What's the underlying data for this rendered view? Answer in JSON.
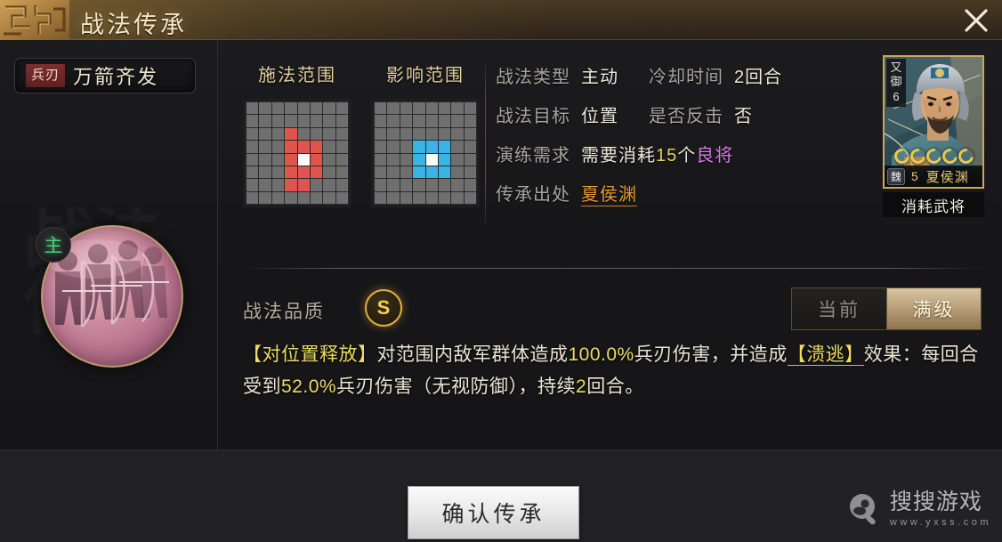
{
  "window": {
    "title": "战法传承",
    "close_icon": "close-icon"
  },
  "skill": {
    "type_tag": "兵刃",
    "name": "万箭齐发",
    "icon_badge": "主",
    "icon_name": "archers-volley-icon"
  },
  "ranges": {
    "cast_range_label": "施法范围",
    "effect_range_label": "影响范围",
    "grid_size": 8,
    "cast_cells_red": [
      [
        3,
        4
      ],
      [
        4,
        3
      ],
      [
        4,
        4
      ],
      [
        4,
        5
      ],
      [
        2,
        3
      ],
      [
        3,
        3
      ],
      [
        5,
        3
      ],
      [
        6,
        3
      ],
      [
        3,
        5
      ],
      [
        4,
        5
      ],
      [
        5,
        5
      ],
      [
        5,
        4
      ],
      [
        6,
        4
      ]
    ],
    "center_cell": [
      4,
      4
    ],
    "effect_cells_blue": [
      [
        3,
        3
      ],
      [
        3,
        4
      ],
      [
        3,
        5
      ],
      [
        4,
        3
      ],
      [
        4,
        5
      ],
      [
        5,
        3
      ],
      [
        5,
        4
      ],
      [
        5,
        5
      ]
    ]
  },
  "stats": [
    {
      "label": "战法类型",
      "value": "主动"
    },
    {
      "label": "冷却时间",
      "value": "2回合"
    },
    {
      "label": "战法目标",
      "value": "位置"
    },
    {
      "label": "是否反击",
      "value": "否"
    }
  ],
  "requirement": {
    "label": "演练需求",
    "prefix": "需要消耗",
    "count": "15",
    "unit": "个",
    "material": "良将"
  },
  "source": {
    "label": "传承出处",
    "value": "夏侯渊"
  },
  "general_card": {
    "side_badge_line1": "又",
    "side_badge_line2": "御",
    "side_badge_line3": "6",
    "stars": 5,
    "faction": "魏",
    "level": "5",
    "name": "夏侯渊",
    "caption": "消耗武将"
  },
  "quality": {
    "label": "战法品质",
    "grade": "S"
  },
  "level_toggle": {
    "current_label": "当前",
    "max_label": "满级",
    "selected": "满级"
  },
  "description": {
    "seg1": "【对位置释放】",
    "seg2": "对范围内敌军群体造成",
    "seg3": "100.0%",
    "seg4": "兵刃伤害，并造成",
    "seg5": "【溃逃】",
    "seg6": "效果：每回合受到",
    "seg7": "52.0%",
    "seg8": "兵刃伤害（无视防御），持续",
    "seg9": "2",
    "seg10": "回合。"
  },
  "footer": {
    "confirm_label": "确认传承"
  },
  "watermark": {
    "name": "搜搜游戏",
    "url": "www.yxss.com",
    "icon": "search-magnifier-icon"
  },
  "colors": {
    "gold": "#e2cfa2",
    "accent_red": "#e0544f",
    "accent_blue": "#39b4e6",
    "highlight_yellow": "#ecdc63",
    "material_purple": "#d979e8",
    "source_orange": "#e79a33"
  }
}
